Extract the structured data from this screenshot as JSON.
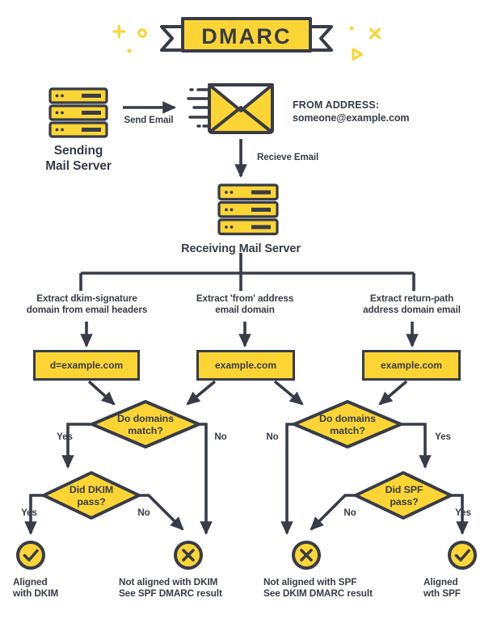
{
  "title_banner": {
    "text": "DMARC",
    "decorations": [
      "plus-icon",
      "ring-icon",
      "dot-icon",
      "small-dot-icon",
      "x-icon",
      "triangle-icon"
    ]
  },
  "colors": {
    "yellow": "#FCD535",
    "dark": "#373C47",
    "white": "#FFFFFF"
  },
  "top_flow": {
    "sending_server_label": "Sending\nMail Server",
    "send_email_label": "Send Email",
    "from_address_title": "FROM ADDRESS:",
    "from_address_value": "someone@example.com",
    "receive_email_label": "Recieve Email",
    "receiving_server_label": "Receiving Mail Server",
    "icons": {
      "sending_server": "server-rack-icon",
      "envelope": "envelope-icon",
      "receiving_server": "server-rack-icon"
    }
  },
  "branches": [
    {
      "extract_label": "Extract dkim-signature\ndomain from email headers",
      "box_value": "d=example.com"
    },
    {
      "extract_label": "Extract 'from' address\nemail domain",
      "box_value": "example.com"
    },
    {
      "extract_label": "Extract return-path\naddress domain email",
      "box_value": "example.com"
    }
  ],
  "decisions": {
    "left_match": {
      "text": "Do domains\nmatch?",
      "yes_label": "Yes",
      "no_label": "No"
    },
    "right_match": {
      "text": "Do domains\nmatch?",
      "no_label": "No",
      "yes_label": "Yes"
    },
    "dkim_pass": {
      "text": "Did DKIM\npass?",
      "yes_label": "Yes",
      "no_label": "No"
    },
    "spf_pass": {
      "text": "Did SPF\npass?",
      "no_label": "No",
      "yes_label": "Yes"
    }
  },
  "results": [
    {
      "icon": "check-circle-icon",
      "status": "pass",
      "label": "Aligned\nwith DKIM"
    },
    {
      "icon": "x-circle-icon",
      "status": "fail",
      "label": "Not aligned with DKIM\nSee SPF DMARC result"
    },
    {
      "icon": "x-circle-icon",
      "status": "fail",
      "label": "Not aligned with SPF\nSee DKIM DMARC result"
    },
    {
      "icon": "check-circle-icon",
      "status": "pass",
      "label": "Aligned\nwth SPF"
    }
  ]
}
